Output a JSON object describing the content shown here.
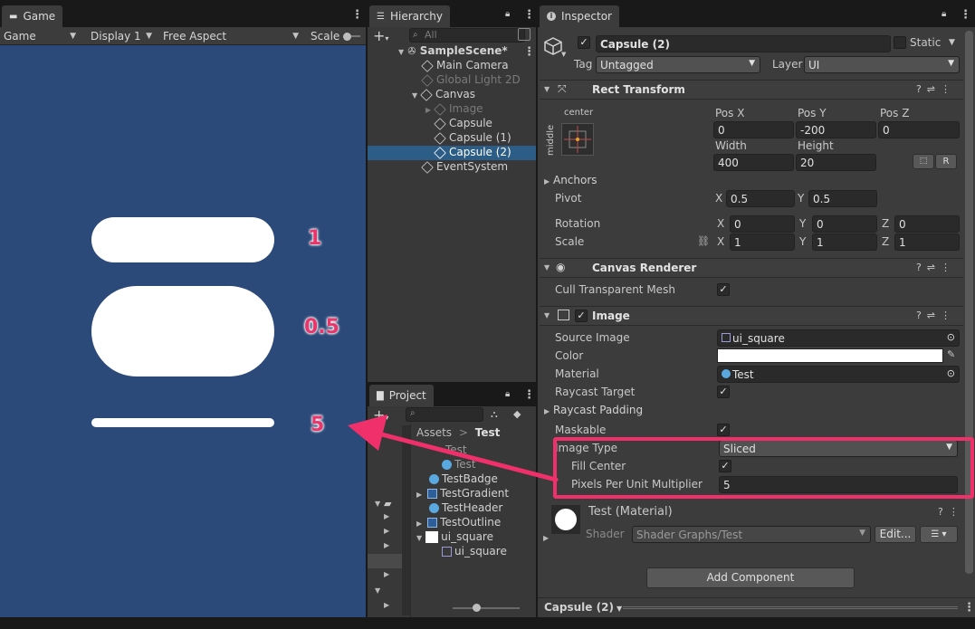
{
  "game": {
    "tab_label": "Game",
    "toolbar": {
      "game_dropdown": "Game",
      "display_dropdown": "Display 1",
      "aspect_dropdown": "Free Aspect",
      "scale_label": "Scale"
    },
    "annotations": [
      "1",
      "0.5",
      "5"
    ]
  },
  "hierarchy": {
    "tab_label": "Hierarchy",
    "search_placeholder": "All",
    "items": [
      {
        "label": "SampleScene*",
        "level": 0,
        "bold": true
      },
      {
        "label": "Main Camera",
        "level": 1
      },
      {
        "label": "Global Light 2D",
        "level": 1,
        "dim": true
      },
      {
        "label": "Canvas",
        "level": 1
      },
      {
        "label": "Image",
        "level": 2,
        "dim": true
      },
      {
        "label": "Capsule",
        "level": 2
      },
      {
        "label": "Capsule (1)",
        "level": 2
      },
      {
        "label": "Capsule (2)",
        "level": 2,
        "selected": true
      },
      {
        "label": "EventSystem",
        "level": 1
      }
    ]
  },
  "project": {
    "tab_label": "Project",
    "breadcrumb_root": "Assets",
    "breadcrumb_current": "Test",
    "items": [
      {
        "label": "Test"
      },
      {
        "label": "Test"
      },
      {
        "label": "TestBadge"
      },
      {
        "label": "TestGradient"
      },
      {
        "label": "TestHeader"
      },
      {
        "label": "TestOutline"
      },
      {
        "label": "ui_square"
      },
      {
        "label": "ui_square"
      }
    ]
  },
  "inspector": {
    "tab_label": "Inspector",
    "object_name": "Capsule (2)",
    "static_label": "Static",
    "tag_label": "Tag",
    "tag_value": "Untagged",
    "layer_label": "Layer",
    "layer_value": "UI",
    "rect_transform": {
      "title": "Rect Transform",
      "anchor_h": "center",
      "anchor_v": "middle",
      "posx_label": "Pos X",
      "posx": "0",
      "posy_label": "Pos Y",
      "posy": "-200",
      "posz_label": "Pos Z",
      "posz": "0",
      "width_label": "Width",
      "width": "400",
      "height_label": "Height",
      "height": "20",
      "anchors_label": "Anchors",
      "pivot_label": "Pivot",
      "pivot_x": "0.5",
      "pivot_y": "0.5",
      "rotation_label": "Rotation",
      "rot_x": "0",
      "rot_y": "0",
      "rot_z": "0",
      "scale_label": "Scale",
      "scale_x": "1",
      "scale_y": "1",
      "scale_z": "1",
      "x": "X",
      "y": "Y",
      "z": "Z",
      "r_button": "R"
    },
    "canvas_renderer": {
      "title": "Canvas Renderer",
      "cull_label": "Cull Transparent Mesh"
    },
    "image": {
      "title": "Image",
      "source_label": "Source Image",
      "source_value": "ui_square",
      "color_label": "Color",
      "material_label": "Material",
      "material_value": "Test",
      "raycast_target_label": "Raycast Target",
      "raycast_padding_label": "Raycast Padding",
      "maskable_label": "Maskable",
      "image_type_label": "Image Type",
      "image_type_value": "Sliced",
      "fill_center_label": "Fill Center",
      "ppu_label": "Pixels Per Unit Multiplier",
      "ppu_value": "5"
    },
    "material": {
      "title": "Test (Material)",
      "shader_label": "Shader",
      "shader_value": "Shader Graphs/Test",
      "edit_button": "Edit..."
    },
    "add_component": "Add Component",
    "footer_label": "Capsule (2)"
  },
  "colors": {
    "game_bg": "#2b4a79",
    "accent_annotation": "#e8366a",
    "selection": "#2c5d87"
  }
}
